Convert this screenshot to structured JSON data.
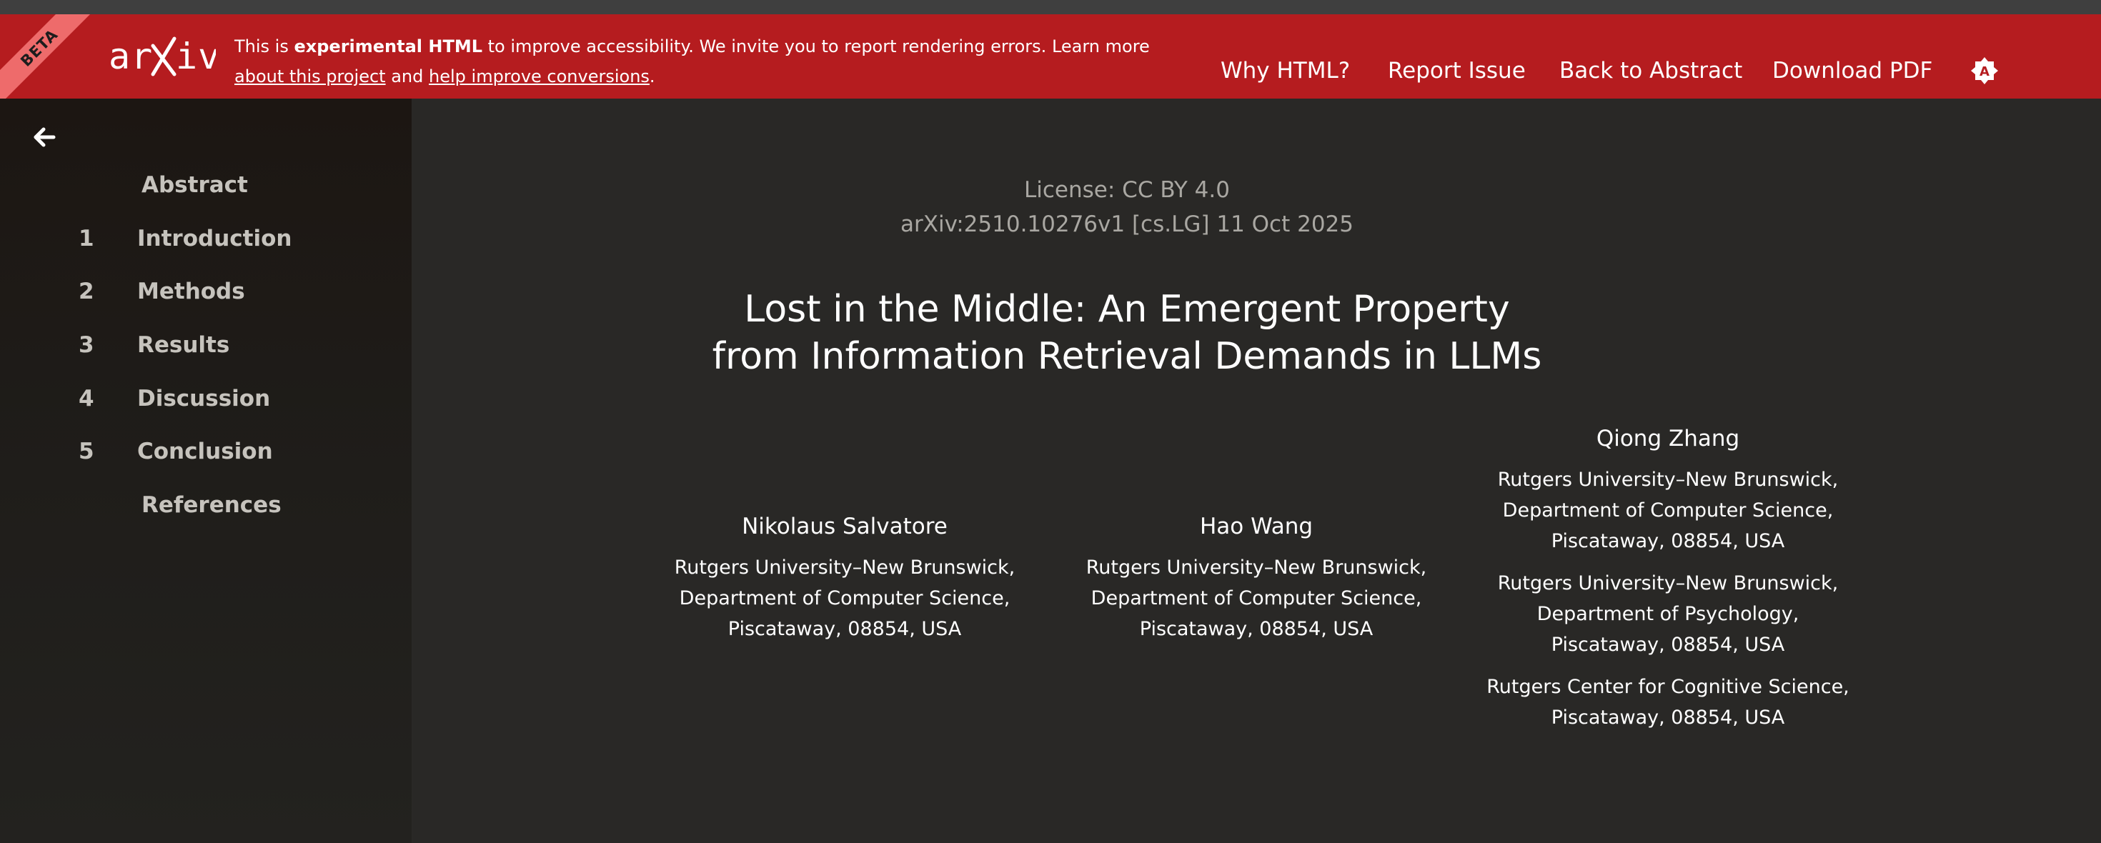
{
  "banner": {
    "beta_label": "BETA",
    "logo_text": "arXiv",
    "notice": {
      "prefix": "This is ",
      "bold": "experimental HTML",
      "middle": " to improve accessibility. We invite you to report rendering errors. Learn more ",
      "link1": "about this project",
      "and": " and ",
      "link2": "help improve conversions",
      "suffix": "."
    },
    "nav": {
      "why_html": "Why HTML?",
      "report_issue": "Report Issue",
      "back_to_abstract": "Back to Abstract",
      "download_pdf": "Download PDF"
    },
    "theme_icon": "theme-toggle-icon",
    "colors": {
      "banner_bg": "#b51c1f",
      "ribbon_bg": "#ee6b6b"
    }
  },
  "sidebar": {
    "back_icon": "arrow-left-icon",
    "toc": [
      {
        "num": "",
        "label": "Abstract"
      },
      {
        "num": "1",
        "label": "Introduction"
      },
      {
        "num": "2",
        "label": "Methods"
      },
      {
        "num": "3",
        "label": "Results"
      },
      {
        "num": "4",
        "label": "Discussion"
      },
      {
        "num": "5",
        "label": "Conclusion"
      },
      {
        "num": "",
        "label": "References"
      }
    ]
  },
  "paper": {
    "license": "License: CC BY 4.0",
    "arxiv_id": "arXiv:2510.10276v1 [cs.LG] 11 Oct 2025",
    "title_line1": "Lost in the Middle: An Emergent Property",
    "title_line2": "from Information Retrieval Demands in LLMs",
    "authors": [
      {
        "name": "Nikolaus Salvatore",
        "affiliations": [
          [
            "Rutgers University–New Brunswick,",
            "Department of Computer Science,",
            "Piscataway, 08854, USA"
          ]
        ]
      },
      {
        "name": "Hao Wang",
        "affiliations": [
          [
            "Rutgers University–New Brunswick,",
            "Department of Computer Science,",
            "Piscataway, 08854, USA"
          ]
        ]
      },
      {
        "name": "Qiong Zhang",
        "affiliations": [
          [
            "Rutgers University–New Brunswick,",
            "Department of Computer Science,",
            "Piscataway, 08854, USA"
          ],
          [
            "Rutgers University–New Brunswick,",
            "Department of Psychology,",
            "Piscataway, 08854, USA"
          ],
          [
            "Rutgers Center for Cognitive Science,",
            "Piscataway, 08854, USA"
          ]
        ]
      }
    ]
  }
}
